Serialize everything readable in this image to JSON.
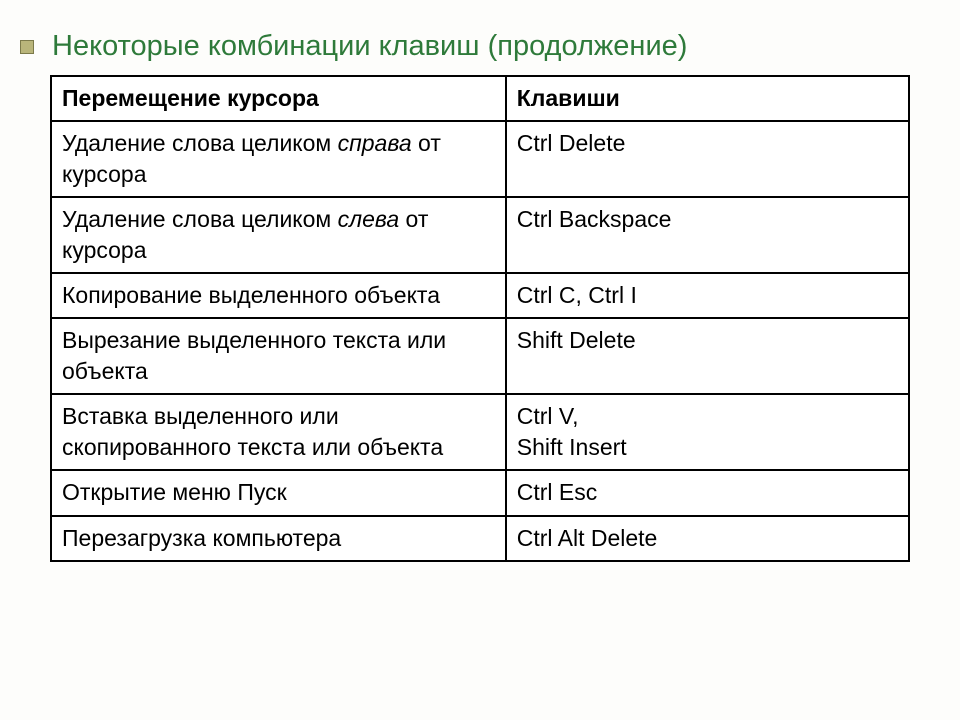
{
  "title": "Некоторые комбинации клавиш (продолжение)",
  "header": {
    "col1": "Перемещение курсора",
    "col2": "Клавиши"
  },
  "rows": [
    {
      "desc_pre": "Удаление слова целиком ",
      "desc_it": "справа",
      "desc_post": " от курсора",
      "keys": "Ctrl   Delete"
    },
    {
      "desc_pre": "Удаление слова целиком ",
      "desc_it": "слева",
      "desc_post": " от курсора",
      "keys": "Ctrl   Backspace"
    },
    {
      "desc_pre": "Копирование выделенного объекта",
      "desc_it": "",
      "desc_post": "",
      "keys": "Ctrl  C,    Ctrl  I"
    },
    {
      "desc_pre": "Вырезание выделенного текста или объекта",
      "desc_it": "",
      "desc_post": "",
      "keys": "Shift  Delete"
    },
    {
      "desc_pre": "Вставка выделенного или скопированного текста или объекта",
      "desc_it": "",
      "desc_post": "",
      "keys": "Ctrl  V,\nShift  Insert"
    },
    {
      "desc_pre": "Открытие меню Пуск",
      "desc_it": "",
      "desc_post": "",
      "keys": "Ctrl  Esc"
    },
    {
      "desc_pre": "Перезагрузка компьютера",
      "desc_it": "",
      "desc_post": "",
      "keys": "Ctrl Alt Delete"
    }
  ]
}
